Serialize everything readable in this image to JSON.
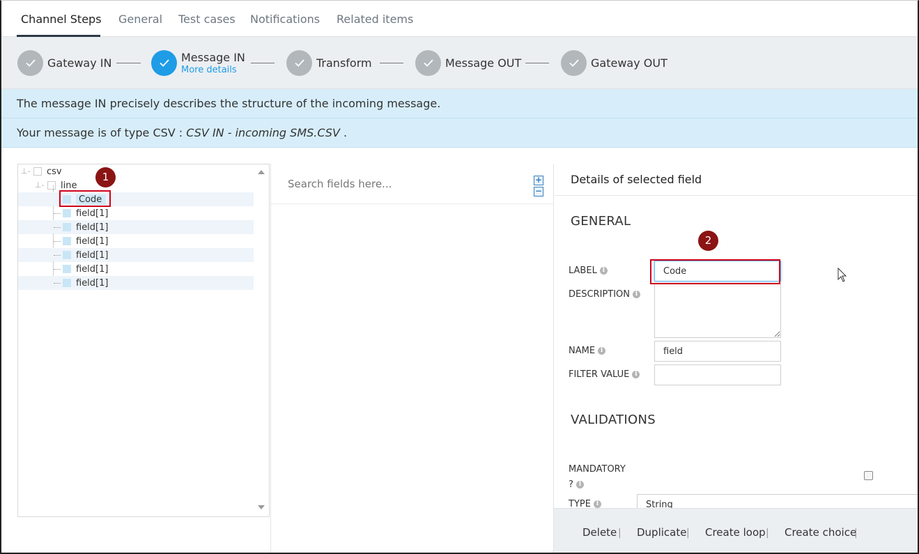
{
  "tabs": [
    {
      "label": "Channel Steps",
      "active": true
    },
    {
      "label": "General",
      "active": false
    },
    {
      "label": "Test cases",
      "active": false
    },
    {
      "label": "Notifications",
      "active": false
    },
    {
      "label": "Related items",
      "active": false
    }
  ],
  "steps": [
    {
      "label": "Gateway IN",
      "sub": "",
      "active": false
    },
    {
      "label": "Message IN",
      "sub": "More details",
      "active": true
    },
    {
      "label": "Transform",
      "sub": "",
      "active": false
    },
    {
      "label": "Message OUT",
      "sub": "",
      "active": false
    },
    {
      "label": "Gateway OUT",
      "sub": "",
      "active": false
    }
  ],
  "info": {
    "line1": "The message IN precisely describes the structure of the incoming message.",
    "line2_prefix": "Your message is of type CSV : ",
    "line2_emph": "CSV IN - incoming SMS.CSV",
    "line2_suffix": " ."
  },
  "tree": {
    "root": "csv",
    "child": "line",
    "fields": [
      "Code",
      "field[1]",
      "field[1]",
      "field[1]",
      "field[1]",
      "field[1]",
      "field[1]"
    ]
  },
  "search": {
    "placeholder": "Search fields here...",
    "expand_label": "+",
    "collapse_label": "−"
  },
  "details": {
    "title": "Details of selected field",
    "general_title": "GENERAL",
    "label_label": "LABEL",
    "label_value": "Code",
    "description_label": "DESCRIPTION",
    "description_value": "",
    "name_label": "NAME",
    "name_value": "field",
    "filter_label": "FILTER VALUE",
    "filter_value": "",
    "validations_title": "VALIDATIONS",
    "mandatory_label_1": "MANDATORY",
    "mandatory_label_2": "?",
    "mandatory_checked": false,
    "type_label": "TYPE",
    "type_value": "String",
    "info_glyph": "i"
  },
  "footer": {
    "delete": "Delete",
    "duplicate": "Duplicate",
    "create_loop": "Create loop",
    "create_choice": "Create choice",
    "separator": "|"
  },
  "annotations": {
    "marker1": "1",
    "marker2": "2",
    "color": "#d0021b",
    "marker_color": "#8b1414"
  },
  "colors": {
    "accent": "#1e9ce6",
    "info_bg": "#d7eefa",
    "stepper_bg": "#eceff2",
    "step_done": "#b2b7bb"
  }
}
